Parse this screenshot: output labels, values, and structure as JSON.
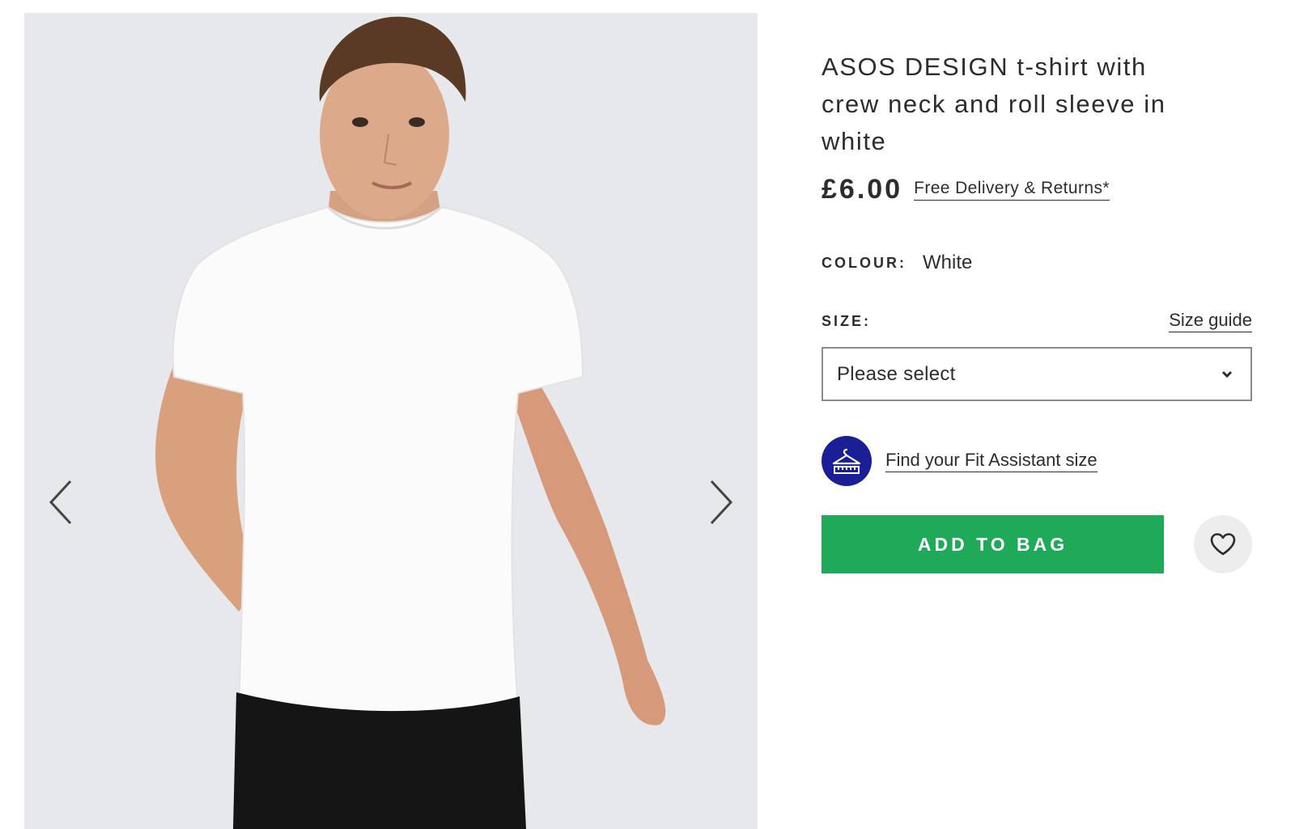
{
  "product": {
    "title": "ASOS DESIGN t-shirt with crew neck and roll sleeve in white",
    "price": "£6.00",
    "delivery_link": "Free Delivery & Returns*"
  },
  "colour": {
    "label": "COLOUR:",
    "value": "White"
  },
  "size": {
    "label": "SIZE:",
    "guide_link": "Size guide",
    "select_value": "Please select"
  },
  "fit_assistant": {
    "link": "Find your Fit Assistant size",
    "icon": "hanger-ruler-icon"
  },
  "actions": {
    "add_to_bag": "ADD TO BAG",
    "save_icon": "heart-icon"
  },
  "gallery": {
    "image_alt": "Model wearing white crew neck t-shirt and black jeans",
    "prev_icon": "chevron-left-icon",
    "next_icon": "chevron-right-icon"
  },
  "colors": {
    "accent_green": "#1eaa58",
    "fit_badge_blue": "#1a1f96",
    "text": "#2d2d2d",
    "gallery_bg": "#e6e8eb"
  }
}
